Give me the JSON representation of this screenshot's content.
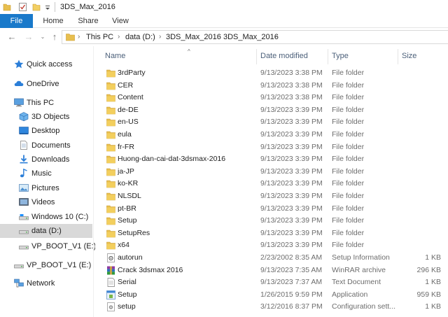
{
  "title_bar": {
    "title": "3DS_Max_2016"
  },
  "ribbon": {
    "tabs": [
      "File",
      "Home",
      "Share",
      "View"
    ]
  },
  "navigation": {
    "back_glyph": "←",
    "forward_glyph": "→",
    "recent_glyph": "⌄",
    "up_glyph": "↑",
    "breadcrumb": [
      "This PC",
      "data (D:)",
      "3DS_Max_2016",
      "3DS_Max_2016"
    ],
    "breadcrumb_sep": "›"
  },
  "sidebar": {
    "items": [
      {
        "label": "Quick access",
        "icon": "star-icon",
        "indent": 0
      },
      {
        "label": "OneDrive",
        "icon": "cloud-icon",
        "indent": 0
      },
      {
        "label": "This PC",
        "icon": "computer-icon",
        "indent": 0
      },
      {
        "label": "3D Objects",
        "icon": "cube-icon",
        "indent": 1
      },
      {
        "label": "Desktop",
        "icon": "desktop-icon",
        "indent": 1
      },
      {
        "label": "Documents",
        "icon": "documents-icon",
        "indent": 1
      },
      {
        "label": "Downloads",
        "icon": "download-icon",
        "indent": 1
      },
      {
        "label": "Music",
        "icon": "music-icon",
        "indent": 1
      },
      {
        "label": "Pictures",
        "icon": "pictures-icon",
        "indent": 1
      },
      {
        "label": "Videos",
        "icon": "videos-icon",
        "indent": 1
      },
      {
        "label": "Windows 10 (C:)",
        "icon": "drive-icon",
        "indent": 1
      },
      {
        "label": "data (D:)",
        "icon": "drive-icon",
        "indent": 1,
        "selected": true
      },
      {
        "label": "VP_BOOT_V1 (E:)",
        "icon": "drive-icon",
        "indent": 1
      },
      {
        "label": "VP_BOOT_V1 (E:)",
        "icon": "drive-icon",
        "indent": 0
      },
      {
        "label": "Network",
        "icon": "network-icon",
        "indent": 0
      }
    ]
  },
  "columns": {
    "name": "Name",
    "date": "Date modified",
    "type": "Type",
    "size": "Size",
    "sort_caret": "^"
  },
  "files": [
    {
      "name": "3rdParty",
      "date": "9/13/2023 3:38 PM",
      "type": "File folder",
      "size": "",
      "icon": "folder-icon"
    },
    {
      "name": "CER",
      "date": "9/13/2023 3:38 PM",
      "type": "File folder",
      "size": "",
      "icon": "folder-icon"
    },
    {
      "name": "Content",
      "date": "9/13/2023 3:38 PM",
      "type": "File folder",
      "size": "",
      "icon": "folder-icon"
    },
    {
      "name": "de-DE",
      "date": "9/13/2023 3:39 PM",
      "type": "File folder",
      "size": "",
      "icon": "folder-icon"
    },
    {
      "name": "en-US",
      "date": "9/13/2023 3:39 PM",
      "type": "File folder",
      "size": "",
      "icon": "folder-icon"
    },
    {
      "name": "eula",
      "date": "9/13/2023 3:39 PM",
      "type": "File folder",
      "size": "",
      "icon": "folder-icon"
    },
    {
      "name": "fr-FR",
      "date": "9/13/2023 3:39 PM",
      "type": "File folder",
      "size": "",
      "icon": "folder-icon"
    },
    {
      "name": "Huong-dan-cai-dat-3dsmax-2016",
      "date": "9/13/2023 3:39 PM",
      "type": "File folder",
      "size": "",
      "icon": "folder-icon"
    },
    {
      "name": "ja-JP",
      "date": "9/13/2023 3:39 PM",
      "type": "File folder",
      "size": "",
      "icon": "folder-icon"
    },
    {
      "name": "ko-KR",
      "date": "9/13/2023 3:39 PM",
      "type": "File folder",
      "size": "",
      "icon": "folder-icon"
    },
    {
      "name": "NLSDL",
      "date": "9/13/2023 3:39 PM",
      "type": "File folder",
      "size": "",
      "icon": "folder-icon"
    },
    {
      "name": "pt-BR",
      "date": "9/13/2023 3:39 PM",
      "type": "File folder",
      "size": "",
      "icon": "folder-icon"
    },
    {
      "name": "Setup",
      "date": "9/13/2023 3:39 PM",
      "type": "File folder",
      "size": "",
      "icon": "folder-icon"
    },
    {
      "name": "SetupRes",
      "date": "9/13/2023 3:39 PM",
      "type": "File folder",
      "size": "",
      "icon": "folder-icon"
    },
    {
      "name": "x64",
      "date": "9/13/2023 3:39 PM",
      "type": "File folder",
      "size": "",
      "icon": "folder-icon"
    },
    {
      "name": "autorun",
      "date": "2/23/2002 8:35 AM",
      "type": "Setup Information",
      "size": "1 KB",
      "icon": "setup-info-icon"
    },
    {
      "name": "Crack 3dsmax 2016",
      "date": "9/13/2023 7:35 AM",
      "type": "WinRAR archive",
      "size": "296 KB",
      "icon": "winrar-icon"
    },
    {
      "name": "Serial",
      "date": "9/13/2023 7:37 AM",
      "type": "Text Document",
      "size": "1 KB",
      "icon": "text-document-icon"
    },
    {
      "name": "Setup",
      "date": "1/26/2015 9:59 PM",
      "type": "Application",
      "size": "959 KB",
      "icon": "application-icon"
    },
    {
      "name": "setup",
      "date": "3/12/2016 8:37 PM",
      "type": "Configuration sett...",
      "size": "1 KB",
      "icon": "config-settings-icon"
    }
  ],
  "colors": {
    "file_tab": "#1979ca",
    "folder": "#e8bf4f",
    "selected_nav": "#d9d9d9",
    "header_text": "#4c607a"
  }
}
